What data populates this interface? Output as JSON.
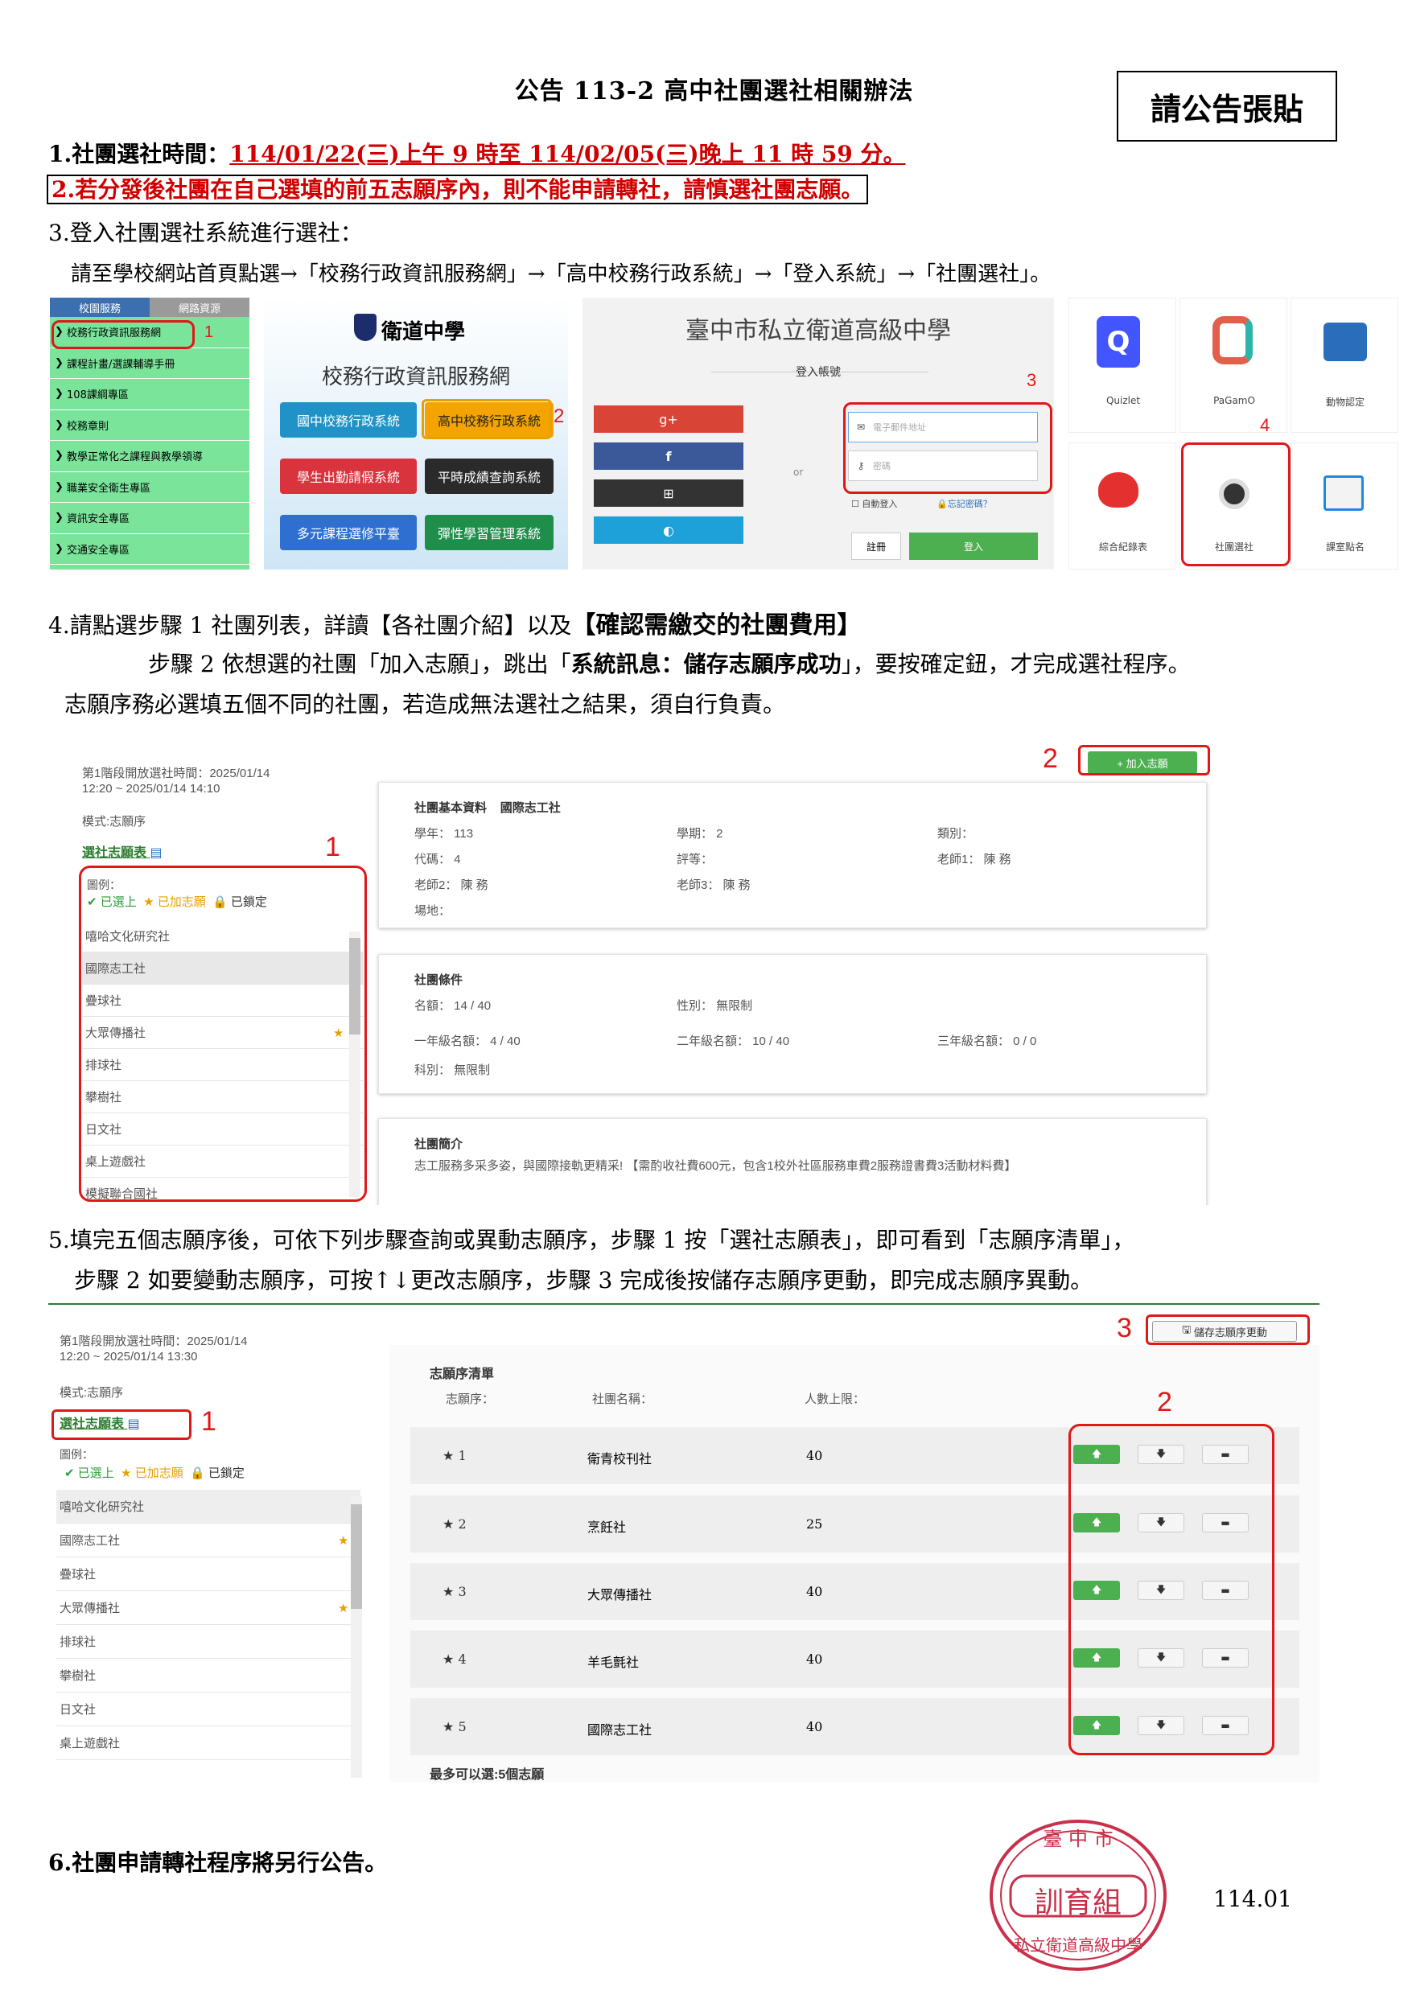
{
  "header": {
    "title": "公告 113-2 高中社團選社相關辦法",
    "post_notice": "請公告張貼"
  },
  "section1": {
    "label": "1.社團選社時間：",
    "time": "114/01/22(三)上午 9 時至 114/02/05(三)晚上 11 時 59 分。"
  },
  "section2": {
    "text": "2.若分發後社團在自己選填的前五志願序內，則不能申請轉社，請慎選社團志願。"
  },
  "section3": {
    "heading": "3.登入社團選社系統進行選社：",
    "instruction": "請至學校網站首頁點選→「校務行政資訊服務網」→「高中校務行政系統」→「登入系統」→「社團選社」。"
  },
  "menu": {
    "tabs": [
      "校園服務",
      "網路資源"
    ],
    "items": [
      "校務行政資訊服務網",
      "課程計畫/選課輔導手冊",
      "108課綱專區",
      "校務章則",
      "教學正常化之課程與教學領導",
      "職業安全衛生專區",
      "資訊安全專區",
      "交通安全專區"
    ]
  },
  "school_system": {
    "school_name": "衛道中學",
    "subtitle": "校務行政資訊服務網",
    "buttons": [
      "國中校務行政系統",
      "高中校務行政系統",
      "學生出勤請假系統",
      "平時成績查詢系統",
      "多元課程選修平臺",
      "彈性學習管理系統"
    ]
  },
  "login": {
    "title": "臺中市私立衛道高級中學",
    "subtitle": "登入帳號",
    "social": [
      "g+",
      "f",
      "⊞",
      "◐"
    ],
    "or": "or",
    "email_placeholder": "電子郵件地址",
    "password_placeholder": "密碼",
    "remember": "自動登入",
    "forgot": "忘記密碼？",
    "register": "註冊",
    "login_button": "登入"
  },
  "apps": [
    "Quizlet",
    "PaGamO",
    "動物認定",
    "綜合紀錄表",
    "社團選社",
    "課室點名"
  ],
  "markers": [
    "1",
    "2",
    "3",
    "4"
  ],
  "section4": {
    "line1a": "4.請點選步驟 1 社團列表，詳讀【各社團介紹】以及",
    "line1b": "【確認需繳交的社團費用】",
    "line2a": "步驟 2 依想選的社團「加入志願」，跳出「",
    "line2b": "系統訊息：儲存志願序成功",
    "line2c": "」，要按確定鈕，才完成選社程序。",
    "line3": "志願序務必選填五個不同的社團，若造成無法選社之結果，須自行負責。"
  },
  "club_ui1": {
    "period": "第1階段開放選社時間：2025/01/14",
    "period2": "12:20 ~ 2025/01/14 14:10",
    "mode": "模式:志願序",
    "wishlist_link": "選社志願表",
    "legend_label": "圖例：",
    "legend": [
      "✔ 已選上",
      "★ 已加志願",
      "🔒 已鎖定"
    ],
    "clubs": [
      "嘻哈文化研究社",
      "國際志工社",
      "疊球社",
      "大眾傳播社",
      "排球社",
      "攀樹社",
      "日文社",
      "桌上遊戲社",
      "模擬聯合國社"
    ],
    "add_button": "+ 加入志願",
    "basic_title": "社團基本資料",
    "club_name": "國際志工社",
    "basic": [
      "學年： 113",
      "學期： 2",
      "類別：",
      "代碼： 4",
      "評等：",
      "老師1： 陳 務",
      "老師2： 陳 務",
      "老師3： 陳 務",
      "場地："
    ],
    "cond_title": "社團條件",
    "cond": [
      "名額： 14 / 40",
      "性別： 無限制",
      "一年級名額： 4 / 40",
      "二年級名額： 10 / 40",
      "三年級名額： 0 / 0",
      "科別： 無限制"
    ],
    "intro_title": "社團簡介",
    "intro": "志工服務多采多姿，與國際接軌更精采! 【需酌收社費600元，包含1校外社區服務車費2服務證書費3活動材料費】"
  },
  "section5": {
    "line1": "5.填完五個志願序後，可依下列步驟查詢或異動志願序，步驟 1 按「選社志願表」，即可看到「志願序清單」，",
    "line2": "步驟 2 如要變動志願序，可按↑↓更改志願序，步驟 3 完成後按儲存志願序更動，即完成志願序異動。"
  },
  "club_ui2": {
    "period": "第1階段開放選社時間：2025/01/14",
    "period2": "12:20 ~ 2025/01/14 13:30",
    "mode": "模式:志願序",
    "wishlist_link": "選社志願表",
    "legend_label": "圖例：",
    "legend": [
      "✔ 已選上",
      "★ 已加志願",
      "🔒 已鎖定"
    ],
    "clubs": [
      "嘻哈文化研究社",
      "國際志工社",
      "疊球社",
      "大眾傳播社",
      "排球社",
      "攀樹社",
      "日文社",
      "桌上遊戲社"
    ],
    "save_button": "儲存志願序更動",
    "list_title": "志願序清單",
    "headers": [
      "志願序：",
      "社團名稱：",
      "人數上限："
    ],
    "rows": [
      {
        "rank": "1",
        "name": "衛青校刊社",
        "limit": "40"
      },
      {
        "rank": "2",
        "name": "烹飪社",
        "limit": "25"
      },
      {
        "rank": "3",
        "name": "大眾傳播社",
        "limit": "40"
      },
      {
        "rank": "4",
        "name": "羊毛氈社",
        "limit": "40"
      },
      {
        "rank": "5",
        "name": "國際志工社",
        "limit": "40"
      }
    ],
    "footer": "最多可以選:5個志願"
  },
  "section6": {
    "text": "6.社團申請轉社程序將另行公告。"
  },
  "stamp": {
    "top": "臺 中 市",
    "middle": "訓育組",
    "bottom": "私立衛道高級中學"
  },
  "doc_number": "114.01"
}
